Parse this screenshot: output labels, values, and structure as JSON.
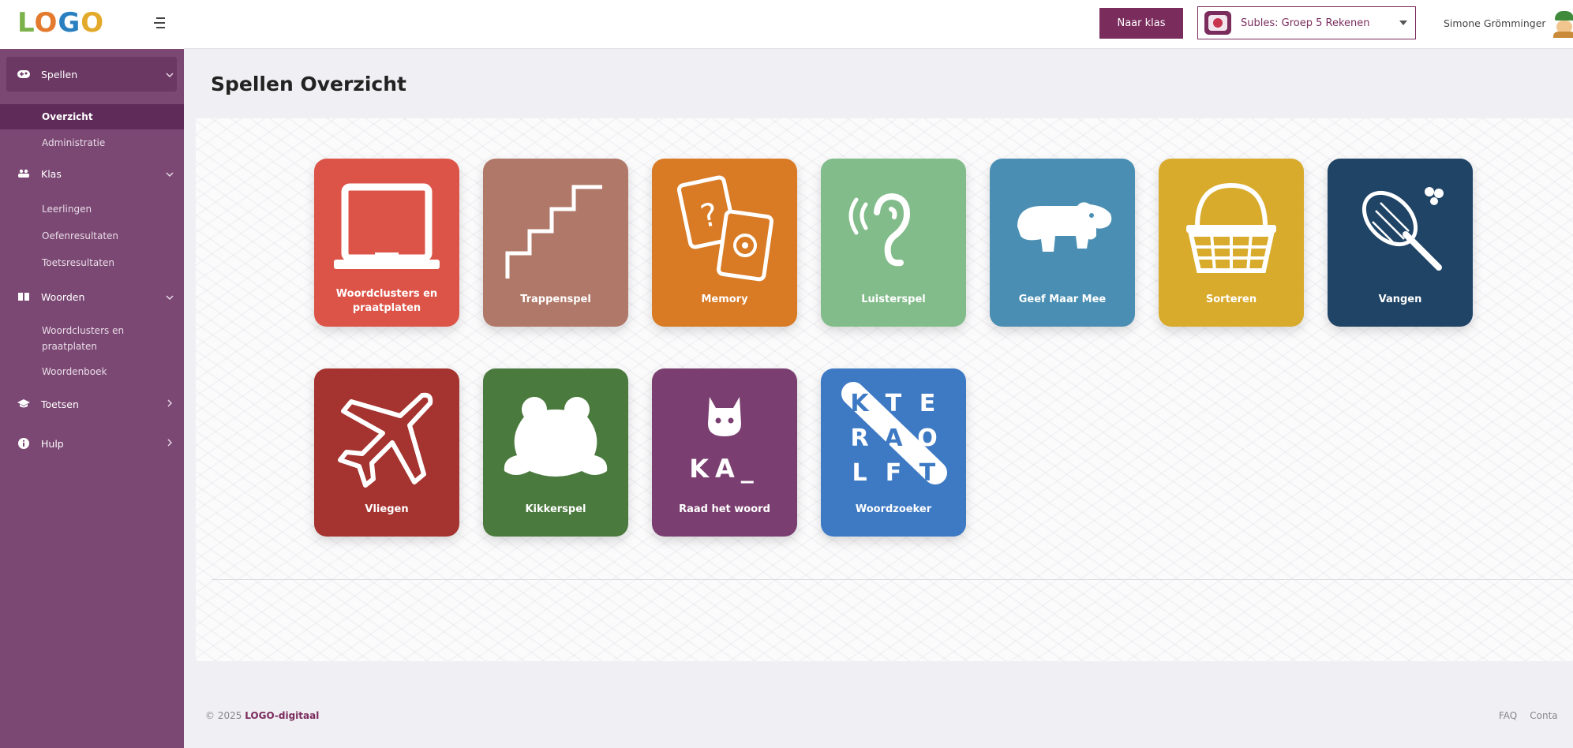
{
  "app": {
    "logo": [
      "L",
      "O",
      "G",
      "O"
    ],
    "colors": {
      "primary": "#7a2c5d",
      "sidebar": "#7b4874",
      "sidebar_active": "#5f2c59"
    }
  },
  "topbar": {
    "class_button_label": "Naar klas",
    "class_selector": {
      "label": "Subles: Groep 5 Rekenen",
      "icon": "class-avatar-icon"
    },
    "user": {
      "name": "Simone Grömminger",
      "icon": "user-avatar-icon"
    }
  },
  "sidebar": {
    "groups": [
      {
        "label": "Spellen",
        "icon": "gamepad-icon",
        "expanded": true,
        "items": [
          {
            "label": "Overzicht",
            "current": true
          },
          {
            "label": "Administratie"
          }
        ]
      },
      {
        "label": "Klas",
        "icon": "users-icon",
        "expanded": true,
        "items": [
          {
            "label": "Leerlingen"
          },
          {
            "label": "Oefenresultaten"
          },
          {
            "label": "Toetsresultaten"
          }
        ]
      },
      {
        "label": "Woorden",
        "icon": "book-icon",
        "expanded": true,
        "items": [
          {
            "label": "Woordclusters en praatplaten"
          },
          {
            "label": "Woordenboek"
          }
        ]
      },
      {
        "label": "Toetsen",
        "icon": "graduation-cap-icon",
        "expanded": false,
        "items": []
      },
      {
        "label": "Hulp",
        "icon": "info-icon",
        "expanded": false,
        "items": []
      }
    ]
  },
  "main": {
    "title": "Spellen Overzicht",
    "games": [
      {
        "label": "Woordclusters en praatplaten",
        "icon": "chalkboard-icon",
        "color": "#dc5448"
      },
      {
        "label": "Trappenspel",
        "icon": "stairs-icon",
        "color": "#b07868"
      },
      {
        "label": "Memory",
        "icon": "memory-cards-icon",
        "color": "#d97a24"
      },
      {
        "label": "Luisterspel",
        "icon": "ear-icon",
        "color": "#82bc8a"
      },
      {
        "label": "Geef Maar Mee",
        "icon": "hippo-icon",
        "color": "#4a8fb3"
      },
      {
        "label": "Sorteren",
        "icon": "basket-icon",
        "color": "#d9ab2c"
      },
      {
        "label": "Vangen",
        "icon": "net-icon",
        "color": "#1f4466"
      },
      {
        "label": "Vliegen",
        "icon": "airplane-icon",
        "color": "#a5332f"
      },
      {
        "label": "Kikkerspel",
        "icon": "frog-icon",
        "color": "#4b7a3e"
      },
      {
        "label": "Raad het woord",
        "icon": "cat-word-icon",
        "color": "#7a3f70",
        "icon_text": "KA_"
      },
      {
        "label": "Woordzoeker",
        "icon": "word-search-icon",
        "color": "#3e7ac4",
        "icon_text": [
          [
            "K",
            "T",
            "E"
          ],
          [
            "R",
            "A",
            "O"
          ],
          [
            "L",
            "F",
            "T"
          ]
        ]
      }
    ]
  },
  "footer": {
    "year": "© 2025",
    "brand": "LOGO-digitaal",
    "links": [
      "FAQ",
      "Conta"
    ]
  }
}
